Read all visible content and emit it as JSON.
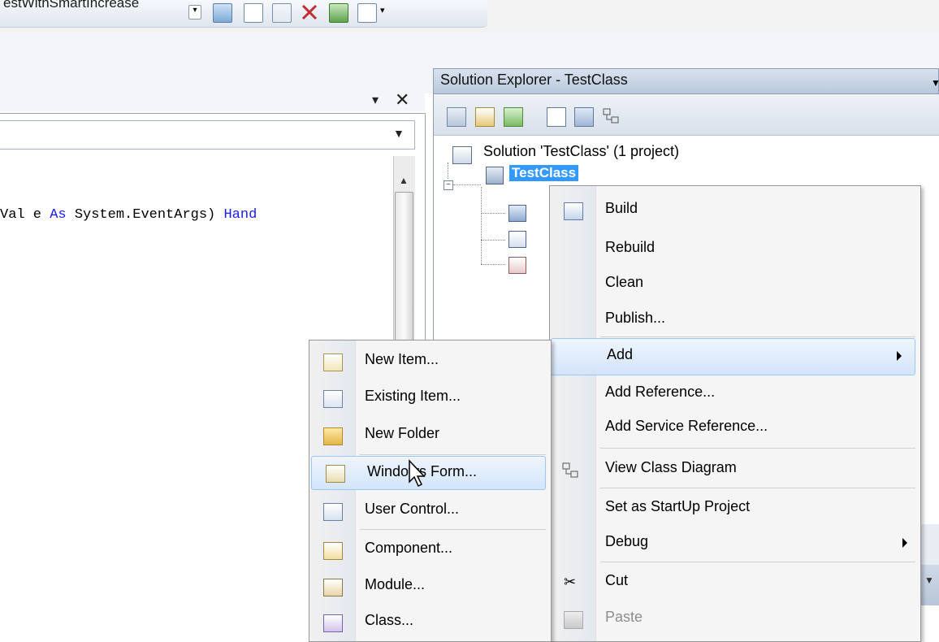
{
  "toolbar": {
    "config_combo_text": "estWithSmartIncrease"
  },
  "editor": {
    "pin_glyph": "▾",
    "close_glyph": "✕",
    "code_line": {
      "part1": "Val e ",
      "kw1": "As",
      "part2": " System.EventArgs) ",
      "kw2": "Hand"
    }
  },
  "solution_explorer": {
    "title": "Solution Explorer - TestClass",
    "solution_label": "Solution 'TestClass' (1 project)",
    "project_label": "TestClass",
    "expander": "−"
  },
  "project_context_menu": {
    "items": [
      {
        "label": "Build"
      },
      {
        "label": "Rebuild"
      },
      {
        "label": "Clean"
      },
      {
        "label": "Publish..."
      },
      {
        "label": "Add"
      },
      {
        "label": "Add Reference..."
      },
      {
        "label": "Add Service Reference..."
      },
      {
        "label": "View Class Diagram"
      },
      {
        "label": "Set as StartUp Project"
      },
      {
        "label": "Debug"
      },
      {
        "label": "Cut"
      },
      {
        "label": "Paste"
      }
    ]
  },
  "add_submenu": {
    "items": [
      {
        "label": "New Item..."
      },
      {
        "label": "Existing Item..."
      },
      {
        "label": "New Folder"
      },
      {
        "label": "Windows Form..."
      },
      {
        "label": "User Control..."
      },
      {
        "label": "Component..."
      },
      {
        "label": "Module..."
      },
      {
        "label": "Class..."
      }
    ]
  },
  "colors": {
    "selection_blue": "#3399ff",
    "keyword_blue": "#1a1aff",
    "menu_highlight": "#d3e5fa"
  }
}
